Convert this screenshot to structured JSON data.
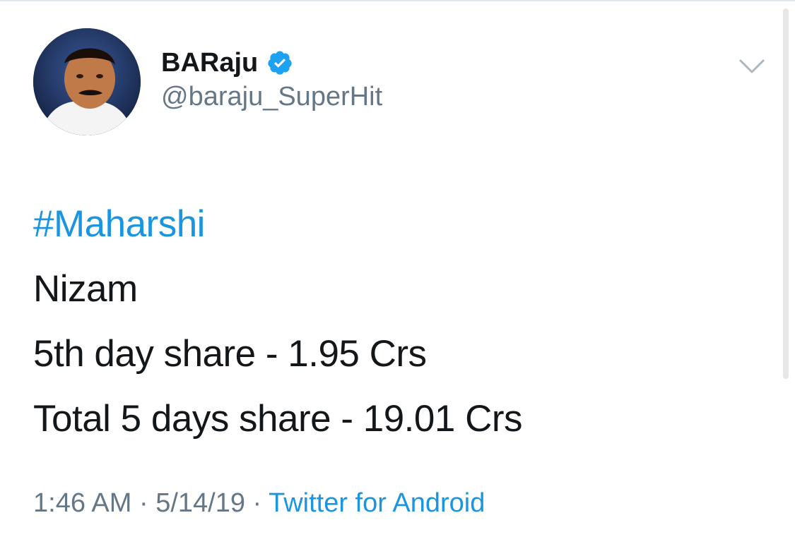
{
  "user": {
    "display_name": "BARaju",
    "handle": "@baraju_SuperHit",
    "verified": true
  },
  "tweet": {
    "hashtag": "#Maharshi",
    "lines": [
      "Nizam",
      "5th day share - 1.95 Crs",
      "Total 5 days share - 19.01 Crs"
    ]
  },
  "meta": {
    "time": "1:46 AM",
    "separator": " · ",
    "date": "5/14/19",
    "source": "Twitter for Android"
  },
  "icons": {
    "verified": "verified-badge-icon",
    "menu": "chevron-down-icon"
  },
  "colors": {
    "link": "#1b95e0",
    "secondary_text": "#657786",
    "primary_text": "#14171a"
  }
}
